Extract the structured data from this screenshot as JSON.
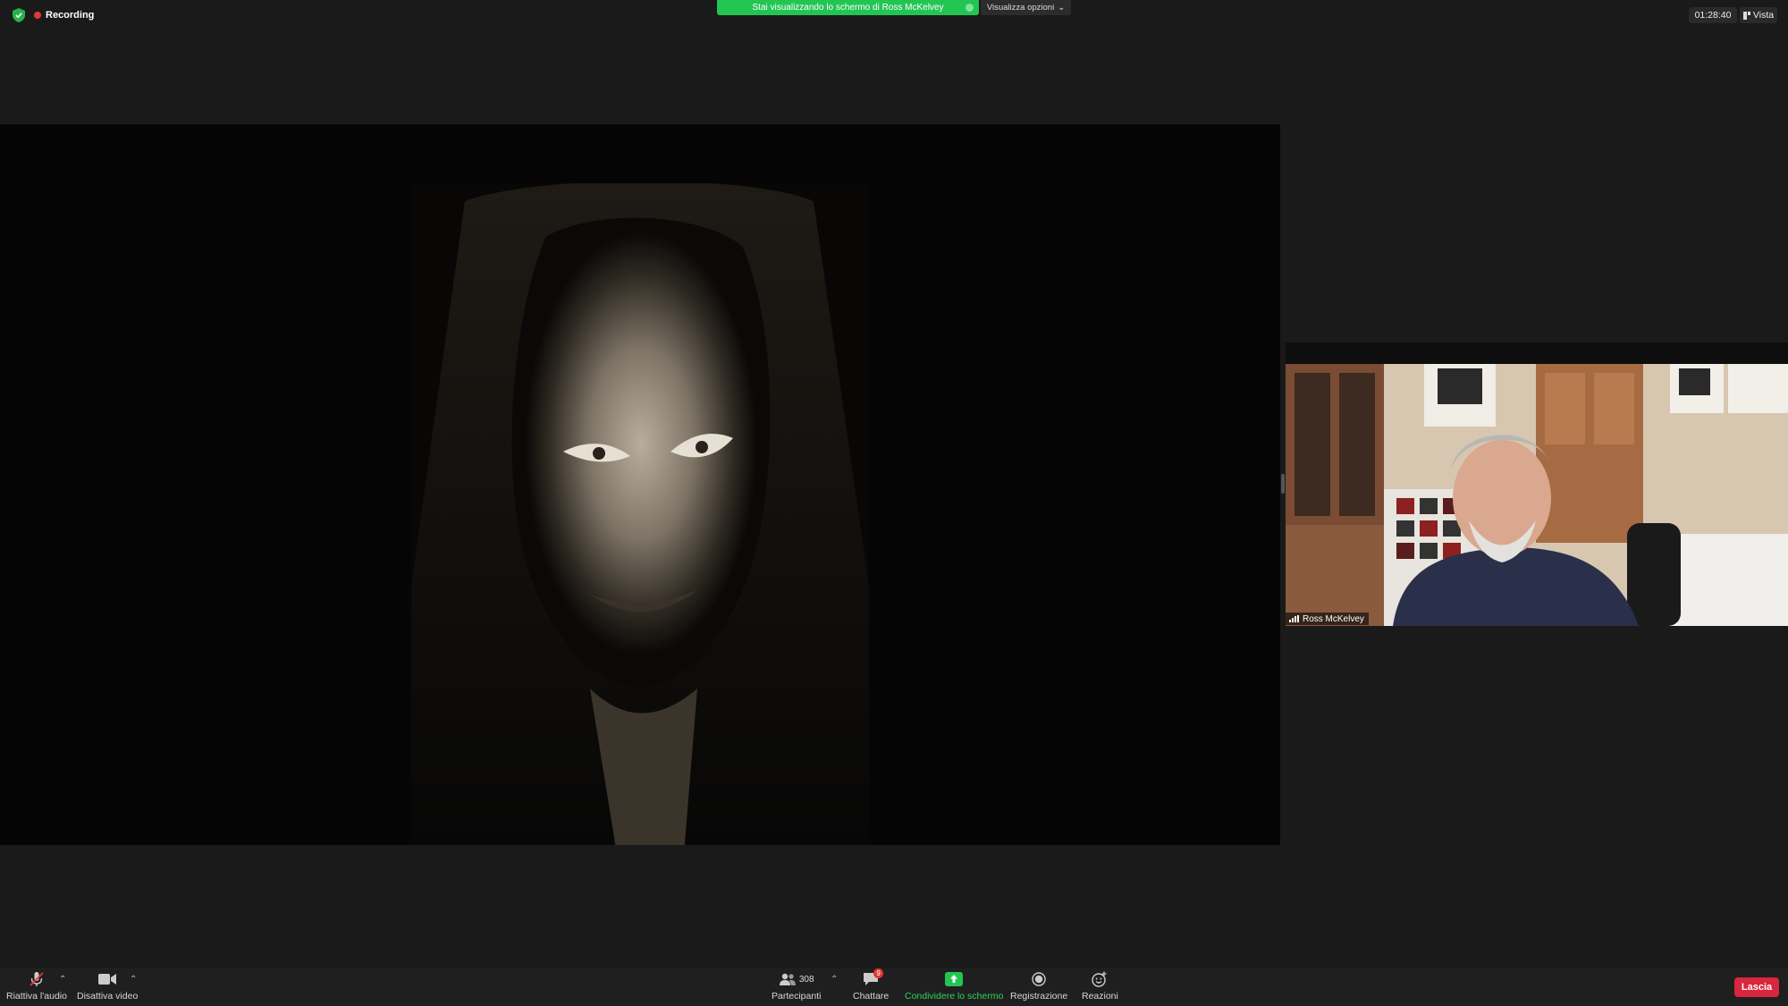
{
  "top": {
    "recording_label": "Recording",
    "share_banner": "Stai visualizzando lo schermo di Ross McKelvey",
    "view_options": "Visualizza opzioni",
    "timer": "01:28:40",
    "view_label": "Vista"
  },
  "video": {
    "participant_name": "Ross McKelvey"
  },
  "toolbar": {
    "unmute_label": "Riattiva l'audio",
    "stop_video_label": "Disattiva video",
    "participants_label": "Partecipanti",
    "participants_count": "308",
    "chat_label": "Chattare",
    "chat_badge": "9",
    "share_screen_label": "Condividere lo schermo",
    "record_label": "Registrazione",
    "reactions_label": "Reazioni",
    "leave_label": "Lascia"
  },
  "colors": {
    "share_green": "#23c552",
    "leave_red": "#d7263d",
    "recording_red": "#e0382f"
  }
}
